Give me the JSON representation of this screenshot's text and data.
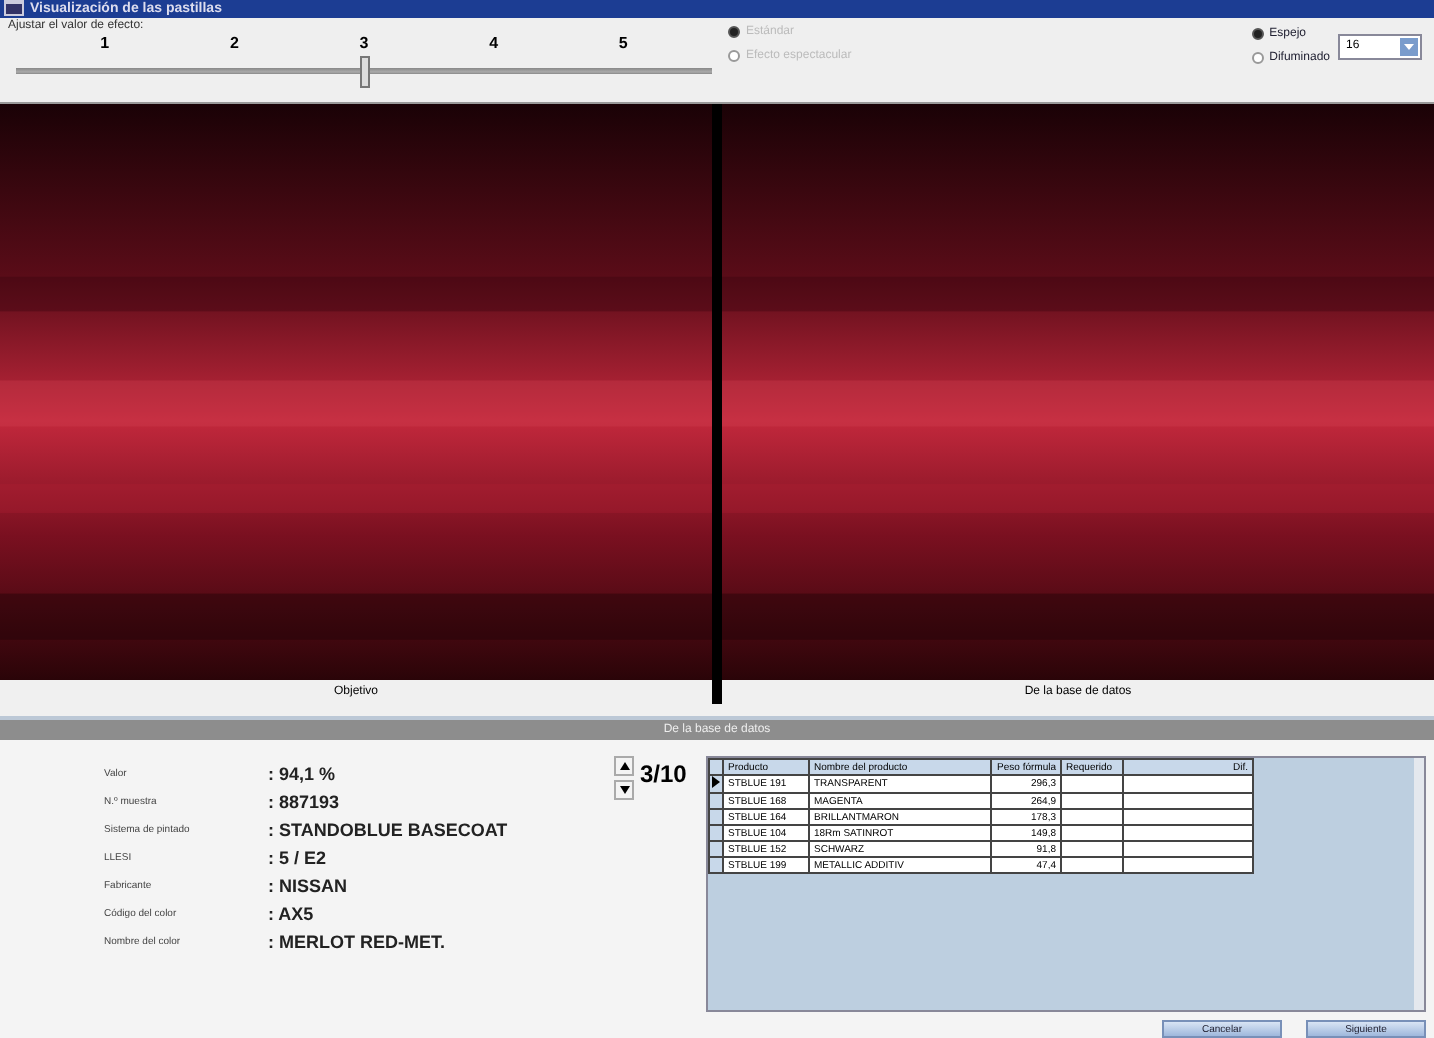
{
  "window": {
    "title": "Visualización de las pastillas"
  },
  "effect": {
    "label": "Ajustar el valor de efecto:",
    "ticks": [
      "1",
      "2",
      "3",
      "4",
      "5"
    ],
    "level": 0.5
  },
  "mode_options": [
    {
      "label": "Estándar",
      "selected": true,
      "disabled": true
    },
    {
      "label": "Efecto espectacular",
      "selected": false,
      "disabled": true
    }
  ],
  "view_options": [
    {
      "label": "Espejo",
      "selected": true
    },
    {
      "label": "Difuminado",
      "selected": false
    }
  ],
  "spin_value": "16",
  "panels": [
    {
      "caption": "Objetivo"
    },
    {
      "caption": "De la base de datos"
    }
  ],
  "section_title": "De la base de datos",
  "details": [
    {
      "label": "Valor",
      "value": ": 94,1 %"
    },
    {
      "label": "N.º muestra",
      "value": ": 887193"
    },
    {
      "label": "Sistema de pintado",
      "value": ": STANDOBLUE BASECOAT"
    },
    {
      "label": "LLESI",
      "value": ": 5 / E2"
    },
    {
      "label": "Fabricante",
      "value": ": NISSAN"
    },
    {
      "label": "Código del color",
      "value": ": AX5"
    },
    {
      "label": "Nombre del color",
      "value": ": MERLOT RED-MET."
    }
  ],
  "pager": "3/10",
  "table": {
    "columns": [
      "Producto",
      "Nombre del producto",
      "Peso fórmula",
      "Requerido",
      "Dif."
    ],
    "rows": [
      {
        "cells": [
          "STBLUE 191",
          "TRANSPARENT",
          "296,3",
          "",
          ""
        ],
        "selected": true
      },
      {
        "cells": [
          "STBLUE 168",
          "MAGENTA",
          "264,9",
          "",
          ""
        ],
        "selected": false
      },
      {
        "cells": [
          "STBLUE 164",
          "BRILLANTMARON",
          "178,3",
          "",
          ""
        ],
        "selected": false
      },
      {
        "cells": [
          "STBLUE 104",
          "18Rm SATINROT",
          "149,8",
          "",
          ""
        ],
        "selected": false
      },
      {
        "cells": [
          "STBLUE 152",
          "SCHWARZ",
          "91,8",
          "",
          ""
        ],
        "selected": false
      },
      {
        "cells": [
          "STBLUE 199",
          "METALLIC ADDITIV",
          "47,4",
          "",
          ""
        ],
        "selected": false
      }
    ]
  },
  "buttons": [
    "Cancelar",
    "Siguiente"
  ]
}
